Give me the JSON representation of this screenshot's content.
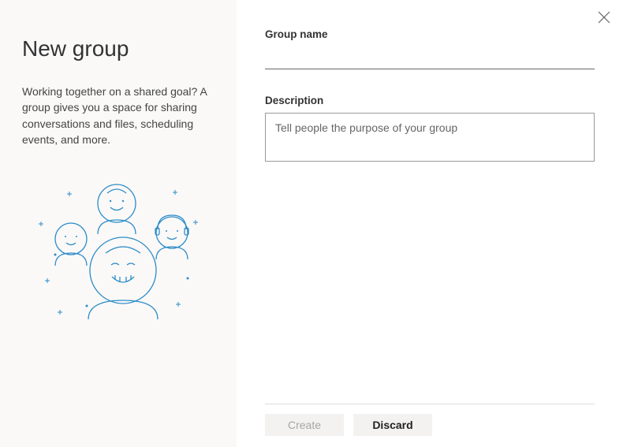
{
  "left": {
    "title": "New group",
    "subtitle": "Working together on a shared goal? A group gives you a space for sharing conversations and files, scheduling events, and more."
  },
  "form": {
    "groupNameLabel": "Group name",
    "groupNameValue": "",
    "descriptionLabel": "Description",
    "descriptionPlaceholder": "Tell people the purpose of your group",
    "descriptionValue": ""
  },
  "buttons": {
    "create": "Create",
    "discard": "Discard"
  }
}
